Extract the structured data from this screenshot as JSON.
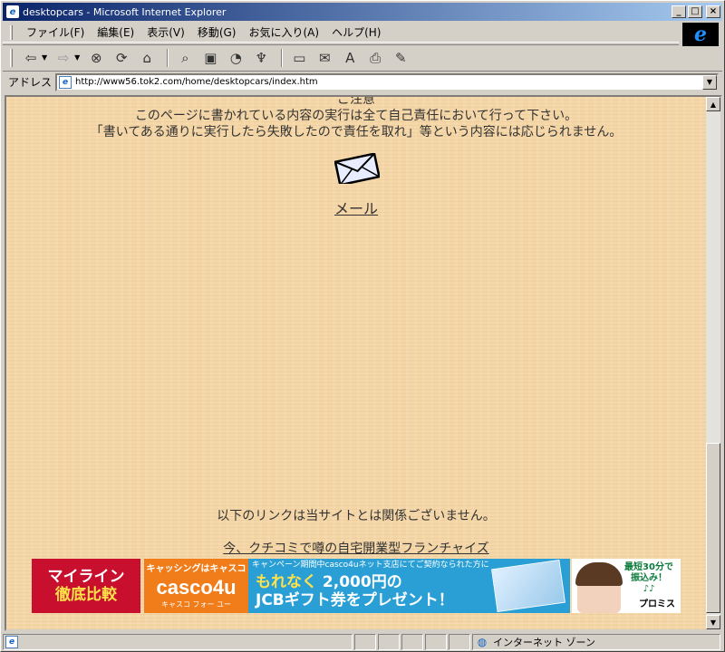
{
  "window": {
    "title": "desktopcars - Microsoft Internet Explorer",
    "minimize": "_",
    "maximize": "□",
    "close": "×"
  },
  "menu": [
    "ファイル(F)",
    "編集(E)",
    "表示(V)",
    "移動(G)",
    "お気に入り(A)",
    "ヘルプ(H)"
  ],
  "toolbar": {
    "icons": [
      "back-icon",
      "forward-icon",
      "stop-icon",
      "refresh-icon",
      "home-icon",
      "search-icon",
      "favorites-icon",
      "history-icon",
      "channels-icon",
      "fullscreen-icon",
      "mail-icon",
      "font-icon",
      "print-icon",
      "edit-icon"
    ]
  },
  "address": {
    "label": "アドレス",
    "url": "http://www56.tok2.com/home/desktopcars/index.htm"
  },
  "page": {
    "cut_line": "ご注意",
    "notice1": "このページに書かれている内容の実行は全て自己責任において行って下さい。",
    "notice2": "「書いてある通りに実行したら失敗したので責任を取れ」等という内容には応じられません。",
    "mail_link": "メール",
    "disclaimer": "以下のリンクは当サイトとは関係ございません。",
    "franchise_link": "今、クチコミで噂の自宅開業型フランチャイズ"
  },
  "banners": {
    "b1_top": "マイライン",
    "b1_bottom": "徹底比較",
    "b2_top": "キャッシングはキャスコ",
    "b2_logo": "casco4u",
    "b2_sub": "キャスコ フォー ユー",
    "b3_top": "キャンペーン期間中casco4uネット支店にてご契約なられた方に",
    "b3_line1_hl": "もれなく",
    "b3_line1": " 2,000円の",
    "b3_line2": "JCBギフト券をプレゼント！",
    "b4_text": "最短30分で振込み！",
    "b4_notes": "♪♪",
    "b4_logo": "プロミス"
  },
  "statusbar": {
    "zone": "インターネット ゾーン"
  },
  "colors": {
    "page_bg": "#f5d6a6",
    "titlebar_start": "#0a246a",
    "titlebar_end": "#a6caf0"
  }
}
